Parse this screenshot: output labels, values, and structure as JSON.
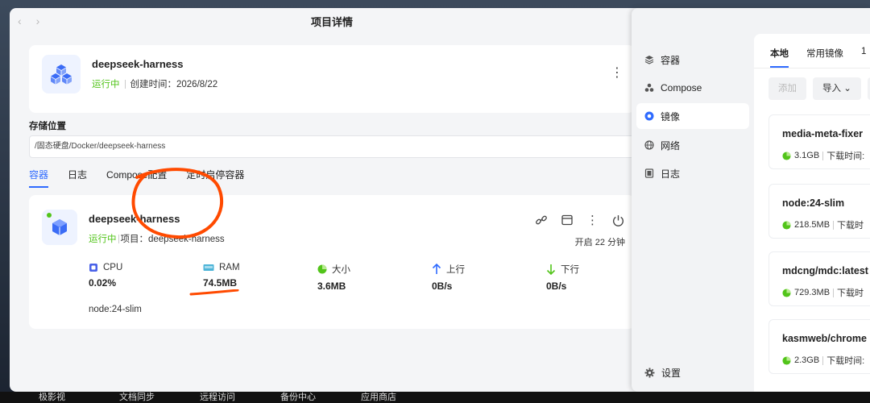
{
  "taskbar": [
    "极影视",
    "文档同步",
    "远程访问",
    "备份中心",
    "应用商店"
  ],
  "left_window": {
    "title": "项目详情",
    "project": {
      "name": "deepseek-harness",
      "status": "运行中",
      "created": "创建时间：2026/8/22"
    },
    "storage": {
      "label": "存储位置",
      "path": "/固态硬盘/Docker/deepseek-harness"
    },
    "tabs": [
      "容器",
      "日志",
      "Compose配置",
      "定时启停容器"
    ],
    "container": {
      "name": "deepseek-harness",
      "status": "运行中",
      "project": "项目：deepseek-harness",
      "uptime": "开启 22 分钟",
      "stats": [
        {
          "label": "CPU",
          "value": "0.02%",
          "icon": "cpu-icon"
        },
        {
          "label": "RAM",
          "value": "74.5MB",
          "icon": "ram-icon"
        },
        {
          "label": "大小",
          "value": "3.6MB",
          "icon": "pie-icon"
        },
        {
          "label": "上行",
          "value": "0B/s",
          "icon": "arrow-up-icon"
        },
        {
          "label": "下行",
          "value": "0B/s",
          "icon": "arrow-down-icon"
        }
      ],
      "image": "node:24-slim"
    }
  },
  "right_window": {
    "sidebar": [
      {
        "label": "容器",
        "icon": "layers-icon"
      },
      {
        "label": "Compose",
        "icon": "compose-icon"
      },
      {
        "label": "镜像",
        "icon": "image-icon"
      },
      {
        "label": "网络",
        "icon": "globe-icon"
      },
      {
        "label": "日志",
        "icon": "log-icon"
      }
    ],
    "settings": "设置",
    "tabs": [
      "本地",
      "常用镜像",
      "1"
    ],
    "buttons": {
      "add": "添加",
      "import": "导入"
    },
    "images": [
      {
        "name": "media-meta-fixer",
        "size": "3.1GB",
        "download": "下载时间:"
      },
      {
        "name": "node:24-slim",
        "size": "218.5MB",
        "download": "下载时"
      },
      {
        "name": "mdcng/mdc:latest",
        "size": "729.3MB",
        "download": "下载时"
      },
      {
        "name": "kasmweb/chrome",
        "size": "2.3GB",
        "download": "下载时间:"
      }
    ]
  },
  "colors": {
    "accent": "#2f6bff",
    "running": "#52c41a",
    "annotation": "#ff4a00"
  }
}
